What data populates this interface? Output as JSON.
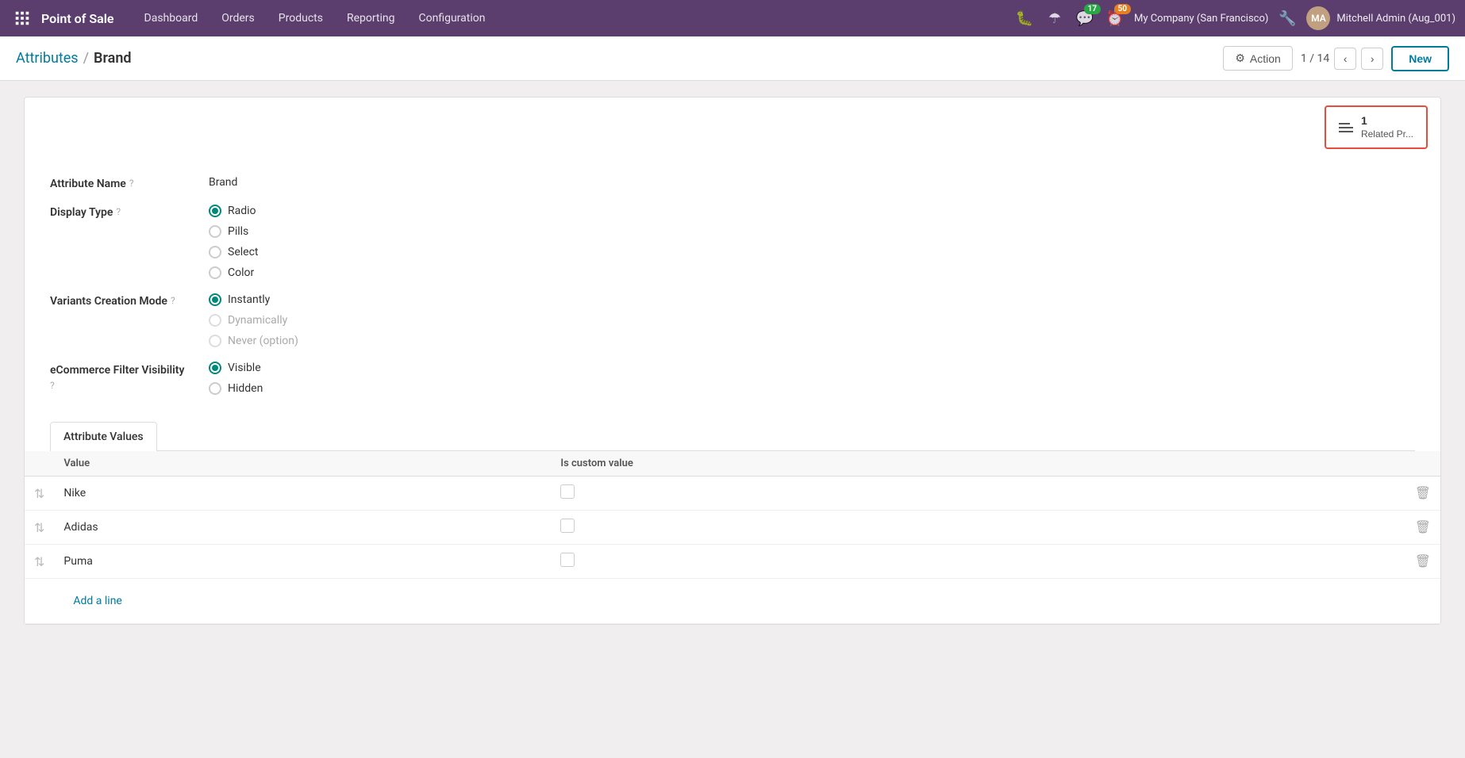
{
  "topnav": {
    "brand": "Point of Sale",
    "menu": [
      {
        "label": "Dashboard",
        "href": "#"
      },
      {
        "label": "Orders",
        "href": "#"
      },
      {
        "label": "Products",
        "href": "#"
      },
      {
        "label": "Reporting",
        "href": "#"
      },
      {
        "label": "Configuration",
        "href": "#"
      }
    ],
    "badge_chat": "17",
    "badge_clock": "50",
    "company": "My Company (San Francisco)",
    "user": "Mitchell Admin (Aug_001)"
  },
  "breadcrumb": {
    "parent": "Attributes",
    "current": "Brand"
  },
  "toolbar": {
    "action_label": "Action",
    "pager_current": "1",
    "pager_total": "14",
    "new_label": "New"
  },
  "related_products": {
    "count": "1",
    "label": "Related Pr..."
  },
  "form": {
    "attribute_name_label": "Attribute Name",
    "attribute_name_help": "?",
    "attribute_name_value": "Brand",
    "display_type_label": "Display Type",
    "display_type_help": "?",
    "display_type_options": [
      {
        "label": "Radio",
        "checked": true,
        "disabled": false
      },
      {
        "label": "Pills",
        "checked": false,
        "disabled": false
      },
      {
        "label": "Select",
        "checked": false,
        "disabled": false
      },
      {
        "label": "Color",
        "checked": false,
        "disabled": false
      }
    ],
    "variants_label": "Variants Creation Mode",
    "variants_help": "?",
    "variants_options": [
      {
        "label": "Instantly",
        "checked": true,
        "disabled": false
      },
      {
        "label": "Dynamically",
        "checked": false,
        "disabled": true
      },
      {
        "label": "Never (option)",
        "checked": false,
        "disabled": true
      }
    ],
    "ecommerce_label": "eCommerce Filter Visibility",
    "ecommerce_help": "?",
    "ecommerce_options": [
      {
        "label": "Visible",
        "checked": true,
        "disabled": false
      },
      {
        "label": "Hidden",
        "checked": false,
        "disabled": false
      }
    ]
  },
  "tabs": [
    {
      "label": "Attribute Values",
      "active": true
    }
  ],
  "table": {
    "col_value": "Value",
    "col_custom": "Is custom value",
    "rows": [
      {
        "value": "Nike",
        "custom": false
      },
      {
        "value": "Adidas",
        "custom": false
      },
      {
        "value": "Puma",
        "custom": false
      }
    ],
    "add_line": "Add a line"
  }
}
